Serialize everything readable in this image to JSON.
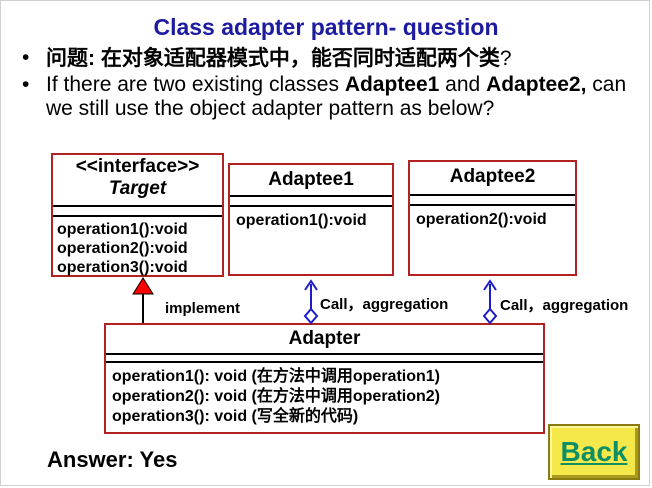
{
  "title": "Class adapter pattern- question",
  "bullets": [
    {
      "marker": "•",
      "parts": [
        {
          "text": "问题",
          "bold": true
        },
        {
          "text": ": ",
          "bold": true
        },
        {
          "text": "在对象适配器模式中，能否同时适配两个类",
          "bold": true
        },
        {
          "text": "?",
          "bold": false
        }
      ]
    },
    {
      "marker": "•",
      "parts": [
        {
          "text": "If there are two existing classes ",
          "bold": false
        },
        {
          "text": "Adaptee1",
          "bold": true
        },
        {
          "text": " and ",
          "bold": false
        },
        {
          "text": "Adaptee2,",
          "bold": true
        },
        {
          "text": " can we still use the object adapter pattern as below?",
          "bold": false
        }
      ]
    }
  ],
  "diagram": {
    "target": {
      "stereotype": "<<interface>>",
      "name": "Target",
      "operations": [
        "operation1():void",
        "operation2():void",
        "operation3():void"
      ]
    },
    "adaptee1": {
      "name": "Adaptee1",
      "operations": [
        "operation1():void"
      ]
    },
    "adaptee2": {
      "name": "Adaptee2",
      "operations": [
        "operation2():void"
      ]
    },
    "adapter": {
      "name": "Adapter",
      "operations": [
        "operation1(): void (在方法中调用operation1)",
        "operation2(): void (在方法中调用operation2)",
        "operation3(): void (写全新的代码)"
      ]
    },
    "labels": {
      "implement": "implement",
      "aggregation1": "Call，aggregation",
      "aggregation2": "Call，aggregation"
    },
    "colors": {
      "box_border": "#b22222",
      "arrow": "#1c1ccc",
      "triangle": "#ff0000"
    }
  },
  "answer": "Answer: Yes",
  "back_button": {
    "label": "Back"
  }
}
